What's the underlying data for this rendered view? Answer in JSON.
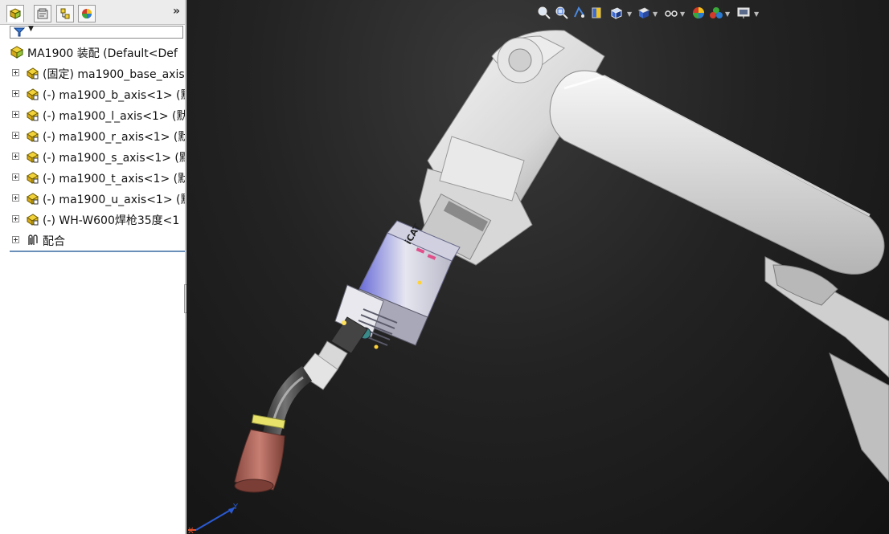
{
  "feature_tree": {
    "tabs": [
      "featuremanager-tab",
      "propertymanager-tab",
      "configurationmanager-tab",
      "display-manager-tab"
    ],
    "expand_symbol": "»",
    "filter_icon": "filter-icon",
    "root": {
      "label": "MA1900 装配  (Default<Def"
    },
    "items": [
      {
        "label": "(固定) ma1900_base_axis"
      },
      {
        "label": "(-) ma1900_b_axis<1> (默"
      },
      {
        "label": "(-) ma1900_l_axis<1> (默"
      },
      {
        "label": "(-) ma1900_r_axis<1> (默"
      },
      {
        "label": "(-) ma1900_s_axis<1> (默"
      },
      {
        "label": "(-) ma1900_t_axis<1> (默"
      },
      {
        "label": "(-) ma1900_u_axis<1> (默"
      },
      {
        "label": "(-) WH-W600焊枪35度<1"
      }
    ],
    "mates": {
      "label": "配合"
    }
  },
  "viewport": {
    "heads_up_toolbar": [
      "zoom-to-fit-icon",
      "zoom-to-area-icon",
      "previous-view-icon",
      "section-view-icon",
      "view-orientation-icon",
      "display-style-icon",
      "hide-show-items-icon",
      "edit-appearance-icon",
      "apply-scene-icon",
      "view-settings-icon"
    ],
    "torch_marking": "iCAT",
    "triad_axes": [
      "Y",
      "X"
    ]
  },
  "colors": {
    "robot_white": "#dcdcdc",
    "panel_accent": "#6a8fb8",
    "torch_body": "#c7c8d6",
    "nozzle": "#b06a60",
    "viewport_bg": "#1a1a1a"
  }
}
